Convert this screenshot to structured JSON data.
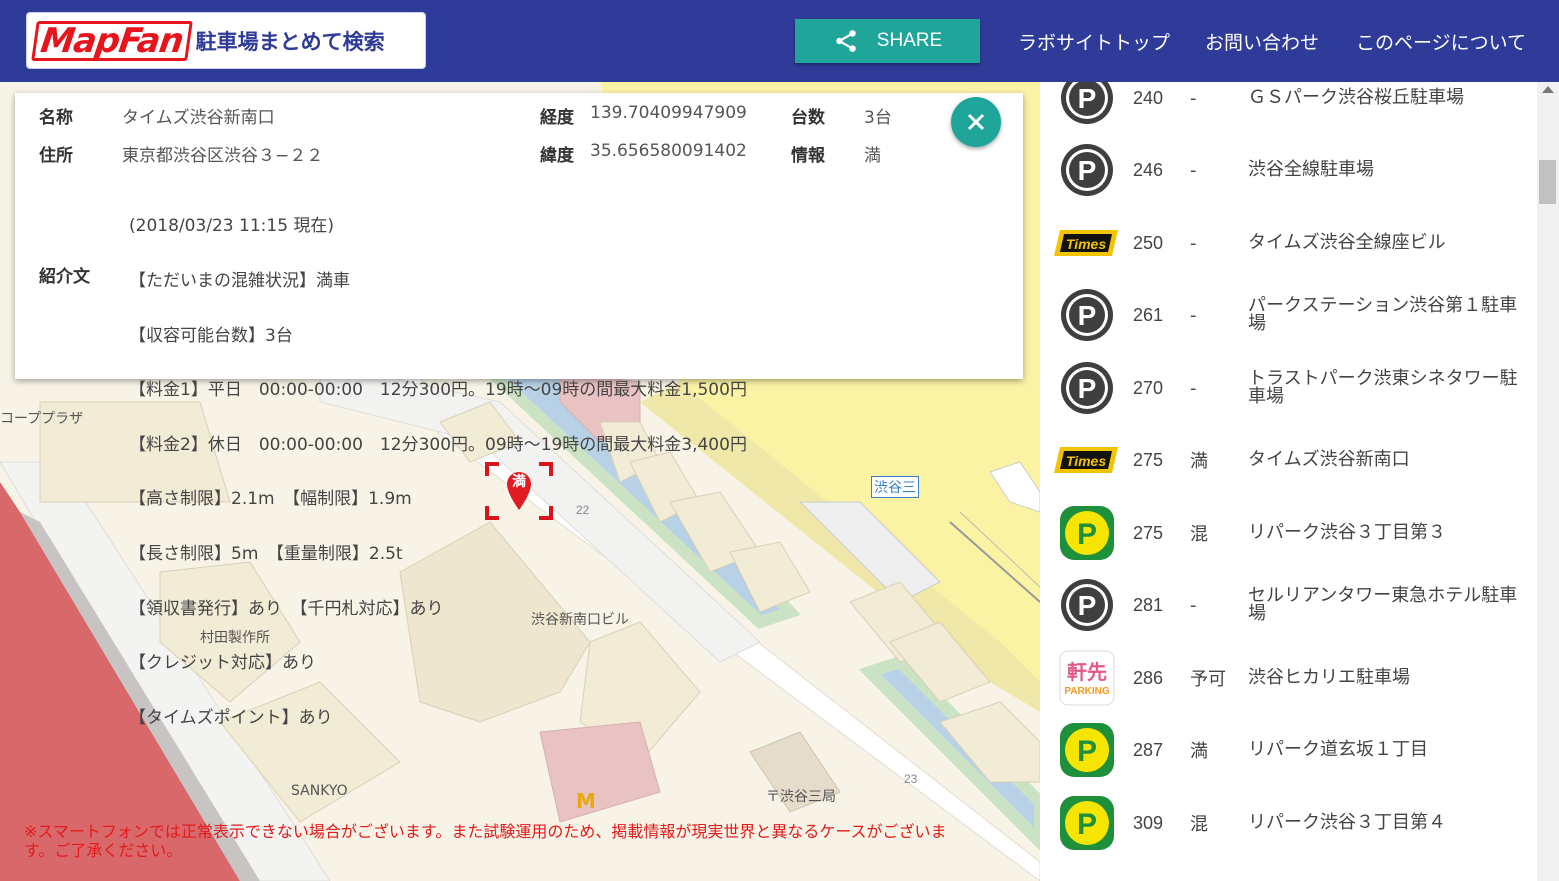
{
  "header": {
    "logo_text": "MapFan",
    "logo_sub": "駐車場まとめて検索",
    "share_label": "SHARE",
    "nav": [
      "ラボサイトトップ",
      "お問い合わせ",
      "このページについて"
    ]
  },
  "info": {
    "name_label": "名称",
    "name_value": "タイムズ渋谷新南口",
    "address_label": "住所",
    "address_value": "東京都渋谷区渋谷３−２２",
    "lng_label": "経度",
    "lng_value": "139.70409947909",
    "lat_label": "緯度",
    "lat_value": "35.656580091402",
    "capacity_label": "台数",
    "capacity_value": "3台",
    "status_label": "情報",
    "status_value": "満",
    "desc_label": "紹介文",
    "desc_lines": [
      "(2018/03/23 11:15 現在)",
      "【ただいまの混雑状況】満車",
      "【収容可能台数】3台",
      "【料金1】平日　00:00-00:00　12分300円。19時～09時の間最大料金1,500円",
      "【料金2】休日　00:00-00:00　12分300円。09時～19時の間最大料金3,400円",
      "【高さ制限】2.1m　【幅制限】1.9m",
      "【長さ制限】5m　【重量制限】2.5t",
      "【領収書発行】あり　【千円札対応】あり",
      "【クレジット対応】あり",
      "【タイムズポイント】あり"
    ]
  },
  "map": {
    "marker_label": "満",
    "labels": {
      "coop": "コーププラザ",
      "murata": "村田製作所",
      "sankyo": "SANKYO",
      "building": "渋谷新南口ビル",
      "post": "〒渋谷三局",
      "station": "渋谷三",
      "num22": "22",
      "num23": "23"
    },
    "notice": "※スマートフォンでは正常表示できない場合がございます。また試験運用のため、掲載情報が現実世界と異なるケースがございます。ご了承ください。"
  },
  "list": [
    {
      "icon": "parking-p-gray-icon",
      "dist": "240",
      "status": "-",
      "name": "ＧＳパーク渋谷桜丘駐車場"
    },
    {
      "icon": "parking-p-gray-icon",
      "dist": "246",
      "status": "-",
      "name": "渋谷全線駐車場"
    },
    {
      "icon": "times-logo-icon",
      "dist": "250",
      "status": "-",
      "name": "タイムズ渋谷全線座ビル"
    },
    {
      "icon": "parking-p-gray-icon",
      "dist": "261",
      "status": "-",
      "name": "パークステーション渋谷第１駐車場"
    },
    {
      "icon": "parking-p-gray-icon",
      "dist": "270",
      "status": "-",
      "name": "トラストパーク渋東シネタワー駐車場"
    },
    {
      "icon": "times-logo-icon",
      "dist": "275",
      "status": "満",
      "name": "タイムズ渋谷新南口"
    },
    {
      "icon": "repark-p-green-icon",
      "dist": "275",
      "status": "混",
      "name": "リパーク渋谷３丁目第３"
    },
    {
      "icon": "parking-p-gray-icon",
      "dist": "281",
      "status": "-",
      "name": "セルリアンタワー東急ホテル駐車場"
    },
    {
      "icon": "nokisaki-parking-icon",
      "dist": "286",
      "status": "予可",
      "name": "渋谷ヒカリエ駐車場"
    },
    {
      "icon": "repark-p-green-icon",
      "dist": "287",
      "status": "満",
      "name": "リパーク道玄坂１丁目"
    },
    {
      "icon": "repark-p-green-icon",
      "dist": "309",
      "status": "混",
      "name": "リパーク渋谷３丁目第４"
    }
  ],
  "icon_texts": {
    "times": "Times",
    "nokisaki_top": "軒先",
    "nokisaki_bottom": "PARKING",
    "p": "P"
  },
  "colors": {
    "header": "#2f3b99",
    "accent": "#1fa59a",
    "logo_red": "#e8141b",
    "notice_red": "#e21b1b"
  }
}
